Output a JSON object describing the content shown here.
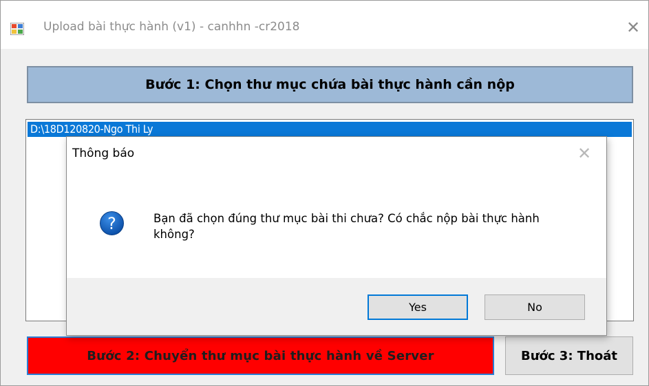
{
  "window": {
    "title": "Upload bài thực hành (v1) - canhhn -cr2018",
    "close_glyph": "✕"
  },
  "main": {
    "step1_label": "Bước 1: Chọn thư mục chứa bài thực hành cần nộp",
    "folder_list": [
      "D:\\18D120820-Ngo Thi Ly"
    ],
    "step2_label": "Bước 2: Chuyển thư mục bài thực hành về Server",
    "step3_label": "Bước 3: Thoát"
  },
  "dialog": {
    "title": "Thông báo",
    "close_glyph": "✕",
    "icon": "question-icon",
    "message": "Bạn đã chọn đúng thư mục bài thi chưa? Có chắc nộp bài thực hành không?",
    "yes_label": "Yes",
    "no_label": "No"
  },
  "colors": {
    "step1_bg": "#9db9d7",
    "step2_bg": "#ff0000",
    "selection": "#0a78d7",
    "focus_border": "#0078d7"
  }
}
